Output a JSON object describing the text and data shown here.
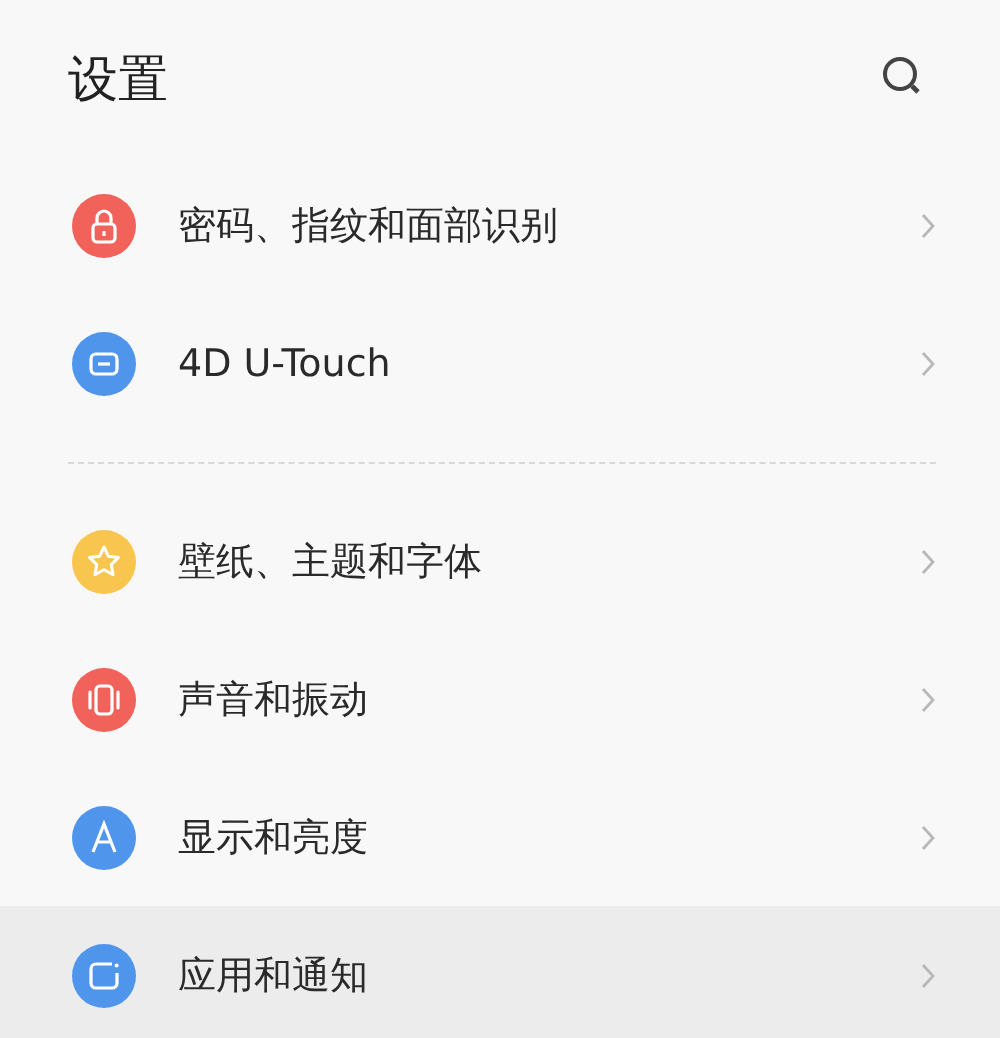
{
  "header": {
    "title": "设置"
  },
  "groups": [
    {
      "items": [
        {
          "kind": "lock",
          "label": "密码、指纹和面部识别",
          "color": "#f0625a",
          "selected": false
        },
        {
          "kind": "touch",
          "label": "4D U-Touch",
          "color": "#4f95ec",
          "selected": false
        }
      ]
    },
    {
      "items": [
        {
          "kind": "star",
          "label": "壁纸、主题和字体",
          "color": "#f8c54e",
          "selected": false
        },
        {
          "kind": "vibrate",
          "label": "声音和振动",
          "color": "#f0625a",
          "selected": false
        },
        {
          "kind": "letter",
          "label": "显示和亮度",
          "color": "#4f95ec",
          "selected": false
        },
        {
          "kind": "app",
          "label": "应用和通知",
          "color": "#4f95ec",
          "selected": true
        }
      ]
    }
  ]
}
